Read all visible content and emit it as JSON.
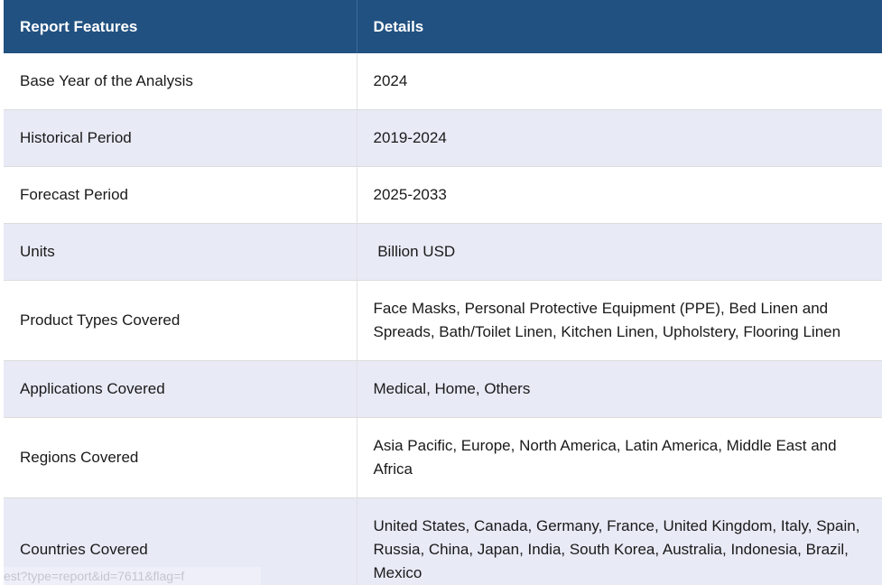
{
  "table": {
    "headers": {
      "feature": "Report Features",
      "details": "Details"
    },
    "rows": [
      {
        "feature": "Base Year of the Analysis",
        "details": "2024"
      },
      {
        "feature": "Historical Period",
        "details": "2019-2024"
      },
      {
        "feature": "Forecast Period",
        "details": "2025-2033"
      },
      {
        "feature": "Units",
        "details": " Billion USD"
      },
      {
        "feature": "Product Types Covered",
        "details": "Face Masks, Personal Protective Equipment (PPE), Bed Linen and Spreads, Bath/Toilet Linen, Kitchen Linen, Upholstery, Flooring Linen"
      },
      {
        "feature": "Applications Covered",
        "details": "Medical, Home, Others"
      },
      {
        "feature": "Regions Covered",
        "details": "Asia Pacific, Europe, North America, Latin America, Middle East and Africa"
      },
      {
        "feature": "Countries Covered",
        "details": "United States, Canada, Germany, France, United Kingdom, Italy, Spain, Russia, China, Japan, India, South Korea, Australia, Indonesia, Brazil, Mexico"
      }
    ]
  },
  "status_link": "est?type=report&id=7611&flag=f",
  "colors": {
    "header_bg": "#215181",
    "alt_row_bg": "#e8eaf6"
  }
}
